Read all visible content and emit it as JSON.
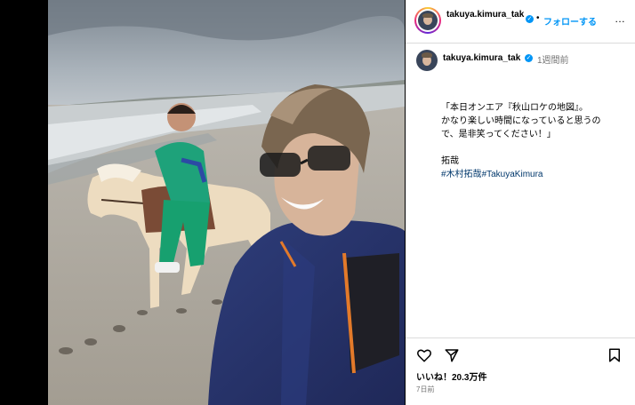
{
  "post": {
    "header": {
      "username": "takuya.kimura_tak",
      "follow_label": "フォローする",
      "separator": "•",
      "more_icon": "…"
    },
    "caption": {
      "username": "takuya.kimura_tak",
      "time_ago": "1週間前",
      "lines": [
        "「本日オンエア『秋山ロケの地図』。",
        "かなり楽しい時間になっていると思うの",
        "で、是非笑ってください！」"
      ],
      "signature": "拓哉",
      "hashtags": [
        "#木村拓哉",
        "#TakuyaKimura"
      ]
    },
    "icons": [
      "heart-icon",
      "share-icon",
      "bookmark-icon",
      "more-icon",
      "verified-icon"
    ],
    "likes_text": "いいね！20.3万件",
    "date_text": "7日前"
  },
  "colors": {
    "link_blue": "#0095f6",
    "hashtag": "#00376b",
    "muted": "#737373",
    "divider": "#dbdbdb"
  }
}
